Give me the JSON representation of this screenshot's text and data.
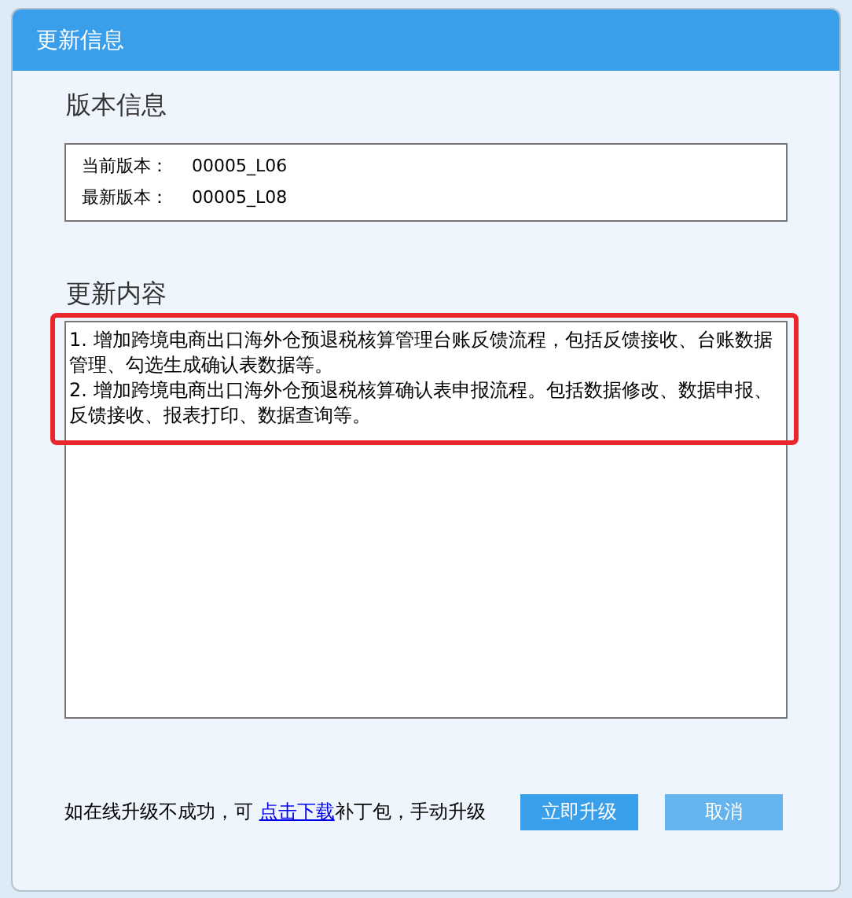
{
  "window": {
    "title": "更新信息"
  },
  "version_section": {
    "title": "版本信息",
    "rows": [
      {
        "label": "当前版本：",
        "value": "00005_L06"
      },
      {
        "label": "最新版本：",
        "value": "00005_L08"
      }
    ]
  },
  "content_section": {
    "title": "更新内容",
    "items": [
      "1.  增加跨境电商出口海外仓预退税核算管理台账反馈流程，包括反馈接收、台账数据管理、勾选生成确认表数据等。",
      "2.  增加跨境电商出口海外仓预退税核算确认表申报流程。包括数据修改、数据申报、反馈接收、报表打印、数据查询等。"
    ],
    "highlighted": true
  },
  "footer": {
    "note_before": "如在线升级不成功，可",
    "link": "点击下载",
    "note_after": "补丁包，手动升级",
    "buttons": [
      {
        "label": "立即升级",
        "kind": "primary"
      },
      {
        "label": "取消",
        "kind": "secondary"
      }
    ]
  }
}
